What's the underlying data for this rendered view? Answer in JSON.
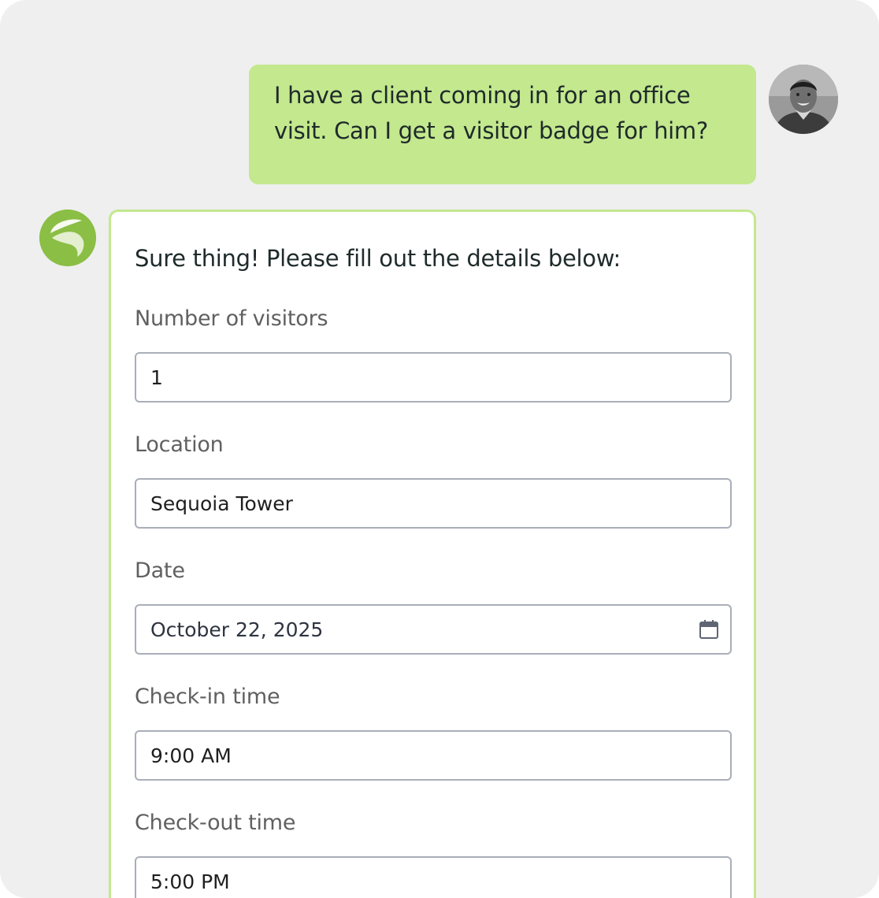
{
  "chat": {
    "user_message": {
      "line1": "I have a client coming in for an office",
      "line2": "visit. Can I get a visitor badge for him?"
    },
    "bot_message": {
      "intro": "Sure thing! Please fill out the details below:",
      "form": {
        "visitors_label": "Number of visitors",
        "visitors_value": "1",
        "location_label": "Location",
        "location_value": "Sequoia Tower",
        "date_label": "Date",
        "date_value": "October 22, 2025",
        "checkin_label": "Check-in time",
        "checkin_value": "9:00 AM",
        "checkout_label": "Check-out time",
        "checkout_value": "5:00 PM"
      }
    }
  },
  "icons": {
    "user_avatar": "user-avatar-photo",
    "bot_logo": "leaf-logo-icon",
    "date_picker": "calendar-icon"
  },
  "colors": {
    "background": "#efefef",
    "user_bubble": "#c3e88e",
    "card_border": "#c3e88e",
    "bot_logo": "#8bbe45",
    "field_border": "#a9afb8",
    "label_text": "#606060"
  }
}
